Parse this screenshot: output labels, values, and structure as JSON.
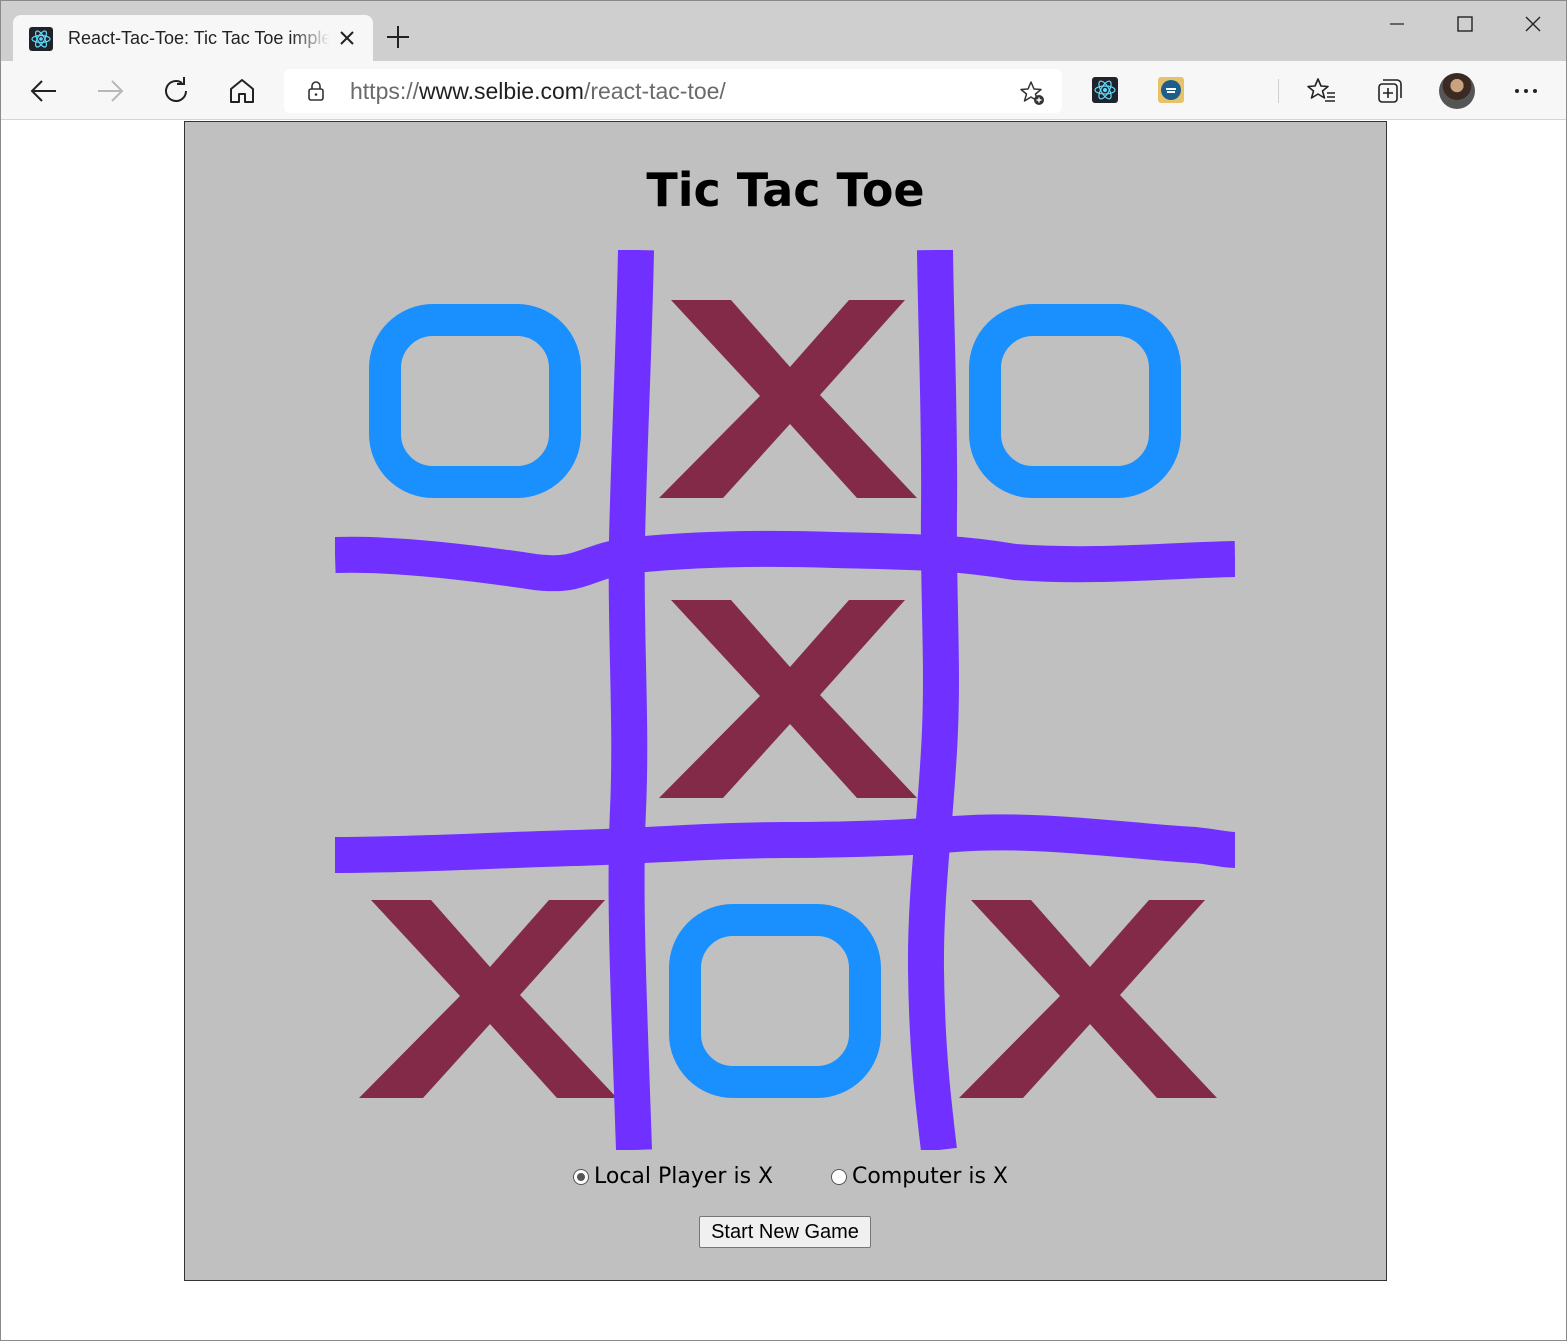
{
  "browser": {
    "tab": {
      "title": "React-Tac-Toe: Tic Tac Toe implementation",
      "favicon": "react-icon"
    },
    "address": {
      "scheme": "https://",
      "host": "www.selbie.com",
      "path": "/react-tac-toe/"
    },
    "extensions": [
      "react-devtools-icon",
      "extension-icon"
    ],
    "window_controls": [
      "minimize-icon",
      "maximize-icon",
      "close-icon"
    ]
  },
  "game": {
    "title": "Tic Tac Toe",
    "board": [
      "O",
      "X",
      "O",
      "",
      "X",
      "",
      "X",
      "O",
      "X"
    ],
    "hover_preview": {
      "cell": 1,
      "mark": "X"
    },
    "options": [
      {
        "label": "Local Player is X",
        "checked": true
      },
      {
        "label": "Computer is X",
        "checked": false
      }
    ],
    "start_button": "Start New Game",
    "colors": {
      "background": "#c0c0c0",
      "grid": "#7030ff",
      "x_mark": "#822a47",
      "o_mark": "#1a90ff",
      "preview": "#c4b6b9"
    }
  }
}
